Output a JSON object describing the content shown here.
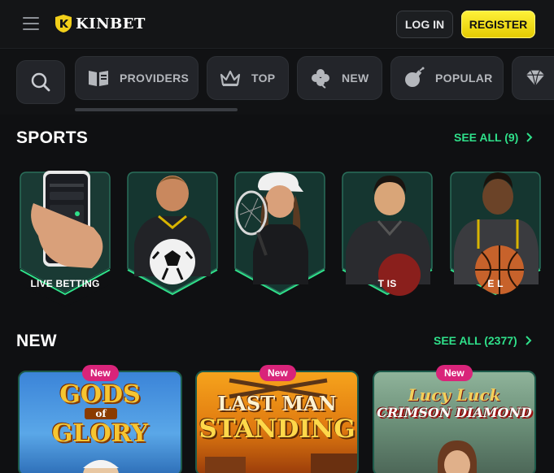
{
  "header": {
    "brand": "KINBET",
    "login_label": "LOG IN",
    "register_label": "REGISTER"
  },
  "categories": [
    {
      "label": "PROVIDERS",
      "icon": "book-icon"
    },
    {
      "label": "TOP",
      "icon": "crown-icon"
    },
    {
      "label": "NEW",
      "icon": "clover-icon"
    },
    {
      "label": "POPULAR",
      "icon": "bomb-icon"
    },
    {
      "label": "",
      "icon": "diamond-icon"
    }
  ],
  "sports": {
    "title": "SPORTS",
    "see_all": "SEE ALL (9)",
    "cards": [
      {
        "label": "LIVE BETTING"
      },
      {
        "label": ""
      },
      {
        "label": ""
      },
      {
        "label": "T           IS"
      },
      {
        "label": "E                    L"
      }
    ]
  },
  "new_games": {
    "title": "NEW",
    "see_all": "SEE ALL (2377)",
    "badge": "New",
    "games": [
      {
        "title_line1": "GODS",
        "title_line2": "of",
        "title_line3": "GLORY"
      },
      {
        "title_line1": "LAST MAN",
        "title_line2": "STANDING"
      },
      {
        "title_line1": "Lucy Luck",
        "title_line2": "CRIMSON DIAMOND"
      }
    ]
  },
  "colors": {
    "accent_green": "#2fe08a",
    "register_yellow": "#f2dc00",
    "badge_pink": "#d9247a",
    "background": "#0f1012"
  }
}
